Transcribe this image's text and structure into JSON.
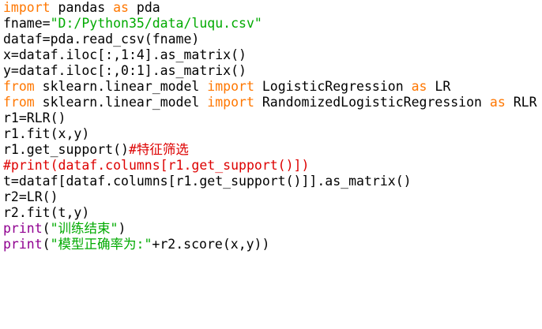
{
  "code_lines": [
    [
      {
        "t": "kw",
        "v": "import"
      },
      {
        "t": "plain",
        "v": " pandas "
      },
      {
        "t": "kw",
        "v": "as"
      },
      {
        "t": "plain",
        "v": " pda"
      }
    ],
    [
      {
        "t": "plain",
        "v": "fname="
      },
      {
        "t": "str",
        "v": "\"D:/Python35/data/luqu.csv\""
      }
    ],
    [
      {
        "t": "plain",
        "v": "dataf=pda.read_csv(fname)"
      }
    ],
    [
      {
        "t": "plain",
        "v": "x=dataf.iloc[:,1:4].as_matrix()"
      }
    ],
    [
      {
        "t": "plain",
        "v": "y=dataf.iloc[:,0:1].as_matrix()"
      }
    ],
    [
      {
        "t": "kw",
        "v": "from"
      },
      {
        "t": "plain",
        "v": " sklearn.linear_model "
      },
      {
        "t": "kw",
        "v": "import"
      },
      {
        "t": "plain",
        "v": " LogisticRegression "
      },
      {
        "t": "kw",
        "v": "as"
      },
      {
        "t": "plain",
        "v": " LR"
      }
    ],
    [
      {
        "t": "kw",
        "v": "from"
      },
      {
        "t": "plain",
        "v": " sklearn.linear_model "
      },
      {
        "t": "kw",
        "v": "import"
      },
      {
        "t": "plain",
        "v": " RandomizedLogisticRegression "
      },
      {
        "t": "kw",
        "v": "as"
      },
      {
        "t": "plain",
        "v": " RLR"
      }
    ],
    [
      {
        "t": "plain",
        "v": "r1=RLR()"
      }
    ],
    [
      {
        "t": "plain",
        "v": "r1.fit(x,y)"
      }
    ],
    [
      {
        "t": "plain",
        "v": "r1.get_support()"
      },
      {
        "t": "cmt",
        "v": "#特征筛选"
      }
    ],
    [
      {
        "t": "cmt",
        "v": "#print(dataf.columns[r1.get_support()])"
      }
    ],
    [
      {
        "t": "plain",
        "v": "t=dataf[dataf.columns[r1.get_support()]].as_matrix()"
      }
    ],
    [
      {
        "t": "plain",
        "v": "r2=LR()"
      }
    ],
    [
      {
        "t": "plain",
        "v": "r2.fit(t,y)"
      }
    ],
    [
      {
        "t": "builtin",
        "v": "print"
      },
      {
        "t": "plain",
        "v": "("
      },
      {
        "t": "str",
        "v": "\"训练结束\""
      },
      {
        "t": "plain",
        "v": ")"
      }
    ],
    [
      {
        "t": "builtin",
        "v": "print"
      },
      {
        "t": "plain",
        "v": "("
      },
      {
        "t": "str",
        "v": "\"模型正确率为:\""
      },
      {
        "t": "plain",
        "v": "+r2.score(x,y))"
      }
    ]
  ],
  "colors": {
    "keyword": "#ff7700",
    "string": "#00aa00",
    "comment": "#dd0000",
    "builtin": "#900090",
    "text": "#000000",
    "background": "#ffffff"
  }
}
